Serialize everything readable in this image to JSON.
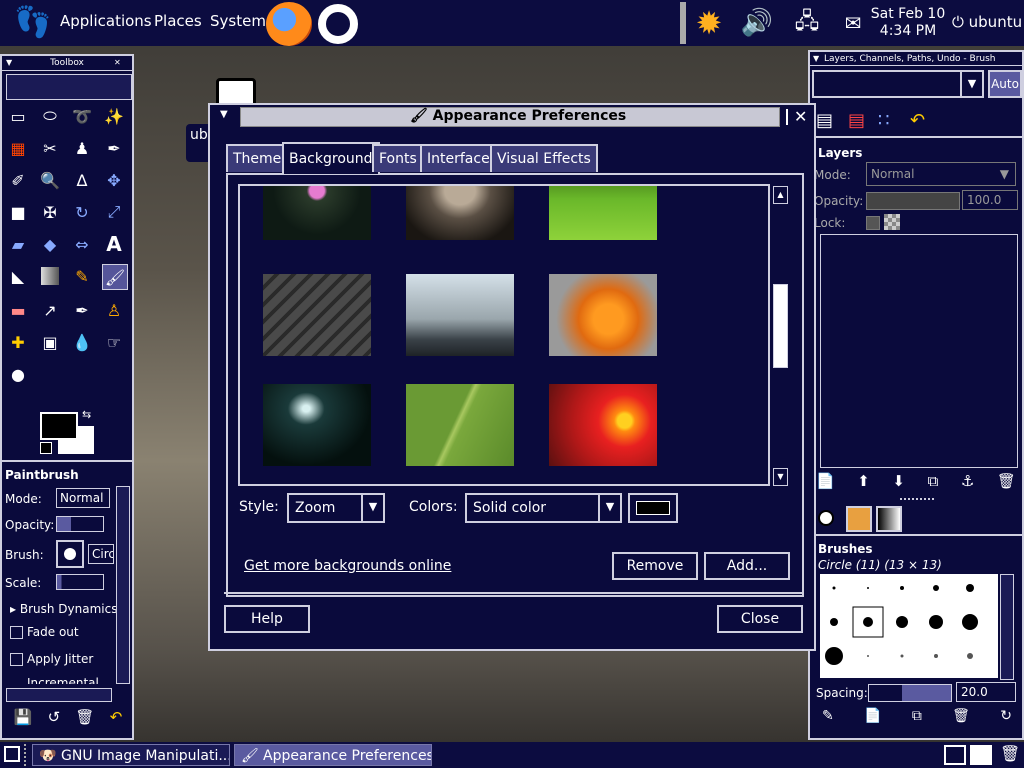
{
  "top_panel": {
    "menus": [
      "Applications",
      "Places",
      "System"
    ],
    "clock_date": "Sat Feb 10",
    "clock_time": "4:34 PM",
    "user": "ubuntu"
  },
  "desktop": {
    "partial_label": "ub"
  },
  "toolbox": {
    "title": "Toolbox",
    "paintbrush_title": "Paintbrush",
    "mode_label": "Mode:",
    "mode_value": "Normal",
    "opacity_label": "Opacity:",
    "brush_label": "Brush:",
    "brush_value": "Circ",
    "scale_label": "Scale:",
    "dynamics_label": "Brush Dynamics",
    "fade_label": "Fade out",
    "jitter_label": "Apply Jitter",
    "incremental_label": "Incremental"
  },
  "layers_dock": {
    "title": "Layers, Channels, Paths, Undo - Brush",
    "auto_label": "Auto",
    "layers_title": "Layers",
    "mode_label": "Mode:",
    "mode_value": "Normal",
    "opacity_label": "Opacity:",
    "opacity_value": "100.0",
    "lock_label": "Lock:",
    "brushes_title": "Brushes",
    "brush_name": "Circle (11) (13 × 13)",
    "spacing_label": "Spacing:",
    "spacing_value": "20.0"
  },
  "dialog": {
    "title": "Appearance Preferences",
    "tabs": [
      "Theme",
      "Background",
      "Fonts",
      "Interface",
      "Visual Effects"
    ],
    "selected_tab": "Background",
    "style_label": "Style:",
    "style_value": "Zoom",
    "colors_label": "Colors:",
    "colors_value": "Solid color",
    "more_link": "Get more backgrounds online",
    "remove_button": "Remove",
    "add_button": "Add...",
    "help_button": "Help",
    "close_button": "Close"
  },
  "taskbar": {
    "tasks": [
      "GNU Image Manipulati...",
      "Appearance Preferences"
    ]
  }
}
